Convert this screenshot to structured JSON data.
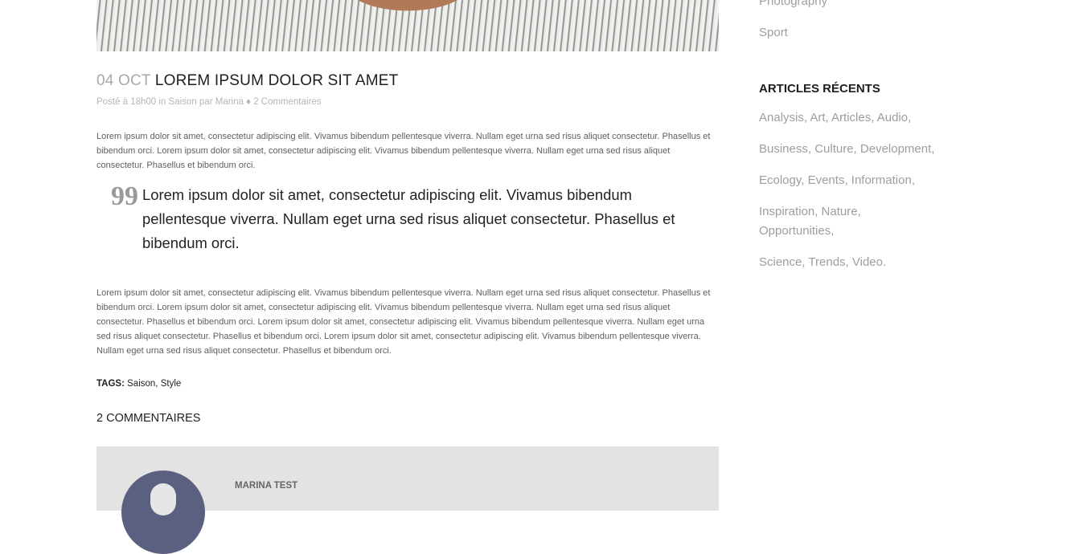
{
  "post": {
    "date": "04 OCT",
    "title": "LOREM IPSUM DOLOR SIT AMET",
    "meta": {
      "posted_prefix": "Posté à",
      "time": "18h00",
      "in_word": "in",
      "category": "Saison",
      "by_word": "par",
      "author": "Marina",
      "separator": "♦",
      "comments_link": "2 Commentaires"
    },
    "paragraph_1": "Lorem ipsum dolor sit amet, consectetur adipiscing elit. Vivamus bibendum pellentesque viverra. Nullam eget urna sed risus aliquet consectetur. Phasellus et bibendum orci. Lorem ipsum dolor sit amet, consectetur adipiscing elit. Vivamus bibendum pellentesque viverra. Nullam eget urna sed risus aliquet consectetur. Phasellus et bibendum orci.",
    "quote_mark": "99",
    "quote": "Lorem ipsum dolor sit amet, consectetur adipiscing elit. Vivamus bibendum pellentesque viverra. Nullam eget urna sed risus aliquet consectetur. Phasellus et bibendum orci.",
    "paragraph_2": "Lorem ipsum dolor sit amet, consectetur adipiscing elit. Vivamus bibendum pellentesque viverra. Nullam eget urna sed risus aliquet consectetur. Phasellus et bibendum orci. Lorem ipsum dolor sit amet, consectetur adipiscing elit. Vivamus bibendum pellentesque viverra. Nullam eget urna sed risus aliquet consectetur. Phasellus et bibendum orci. Lorem ipsum dolor sit amet, consectetur adipiscing elit. Vivamus bibendum pellentesque viverra. Nullam eget urna sed risus aliquet consectetur. Phasellus et bibendum orci. Lorem ipsum dolor sit amet, consectetur adipiscing elit. Vivamus bibendum pellentesque viverra. Nullam eget urna sed risus aliquet consectetur. Phasellus et bibendum orci.",
    "tags": {
      "label": "TAGS:",
      "items": [
        "Saison",
        "Style"
      ],
      "separator": ","
    }
  },
  "comments": {
    "heading": "2 COMMENTAIRES",
    "first_author": "MARINA TEST"
  },
  "sidebar": {
    "categories": [
      "Photography",
      "Sport"
    ],
    "recent_title": "ARTICLES RÉCENTS",
    "recent_lines": [
      "Analysis, Art, Articles, Audio,",
      "Business, Culture, Development,",
      "Ecology, Events, Information,",
      "Inspiration, Nature, Opportunities,",
      "Science, Trends, Video."
    ]
  },
  "colors": {
    "title_dark": "#1e1e1e",
    "muted": "#a9a9a9",
    "comment_bg": "#e3e3e3",
    "avatar": "#5c6080"
  }
}
